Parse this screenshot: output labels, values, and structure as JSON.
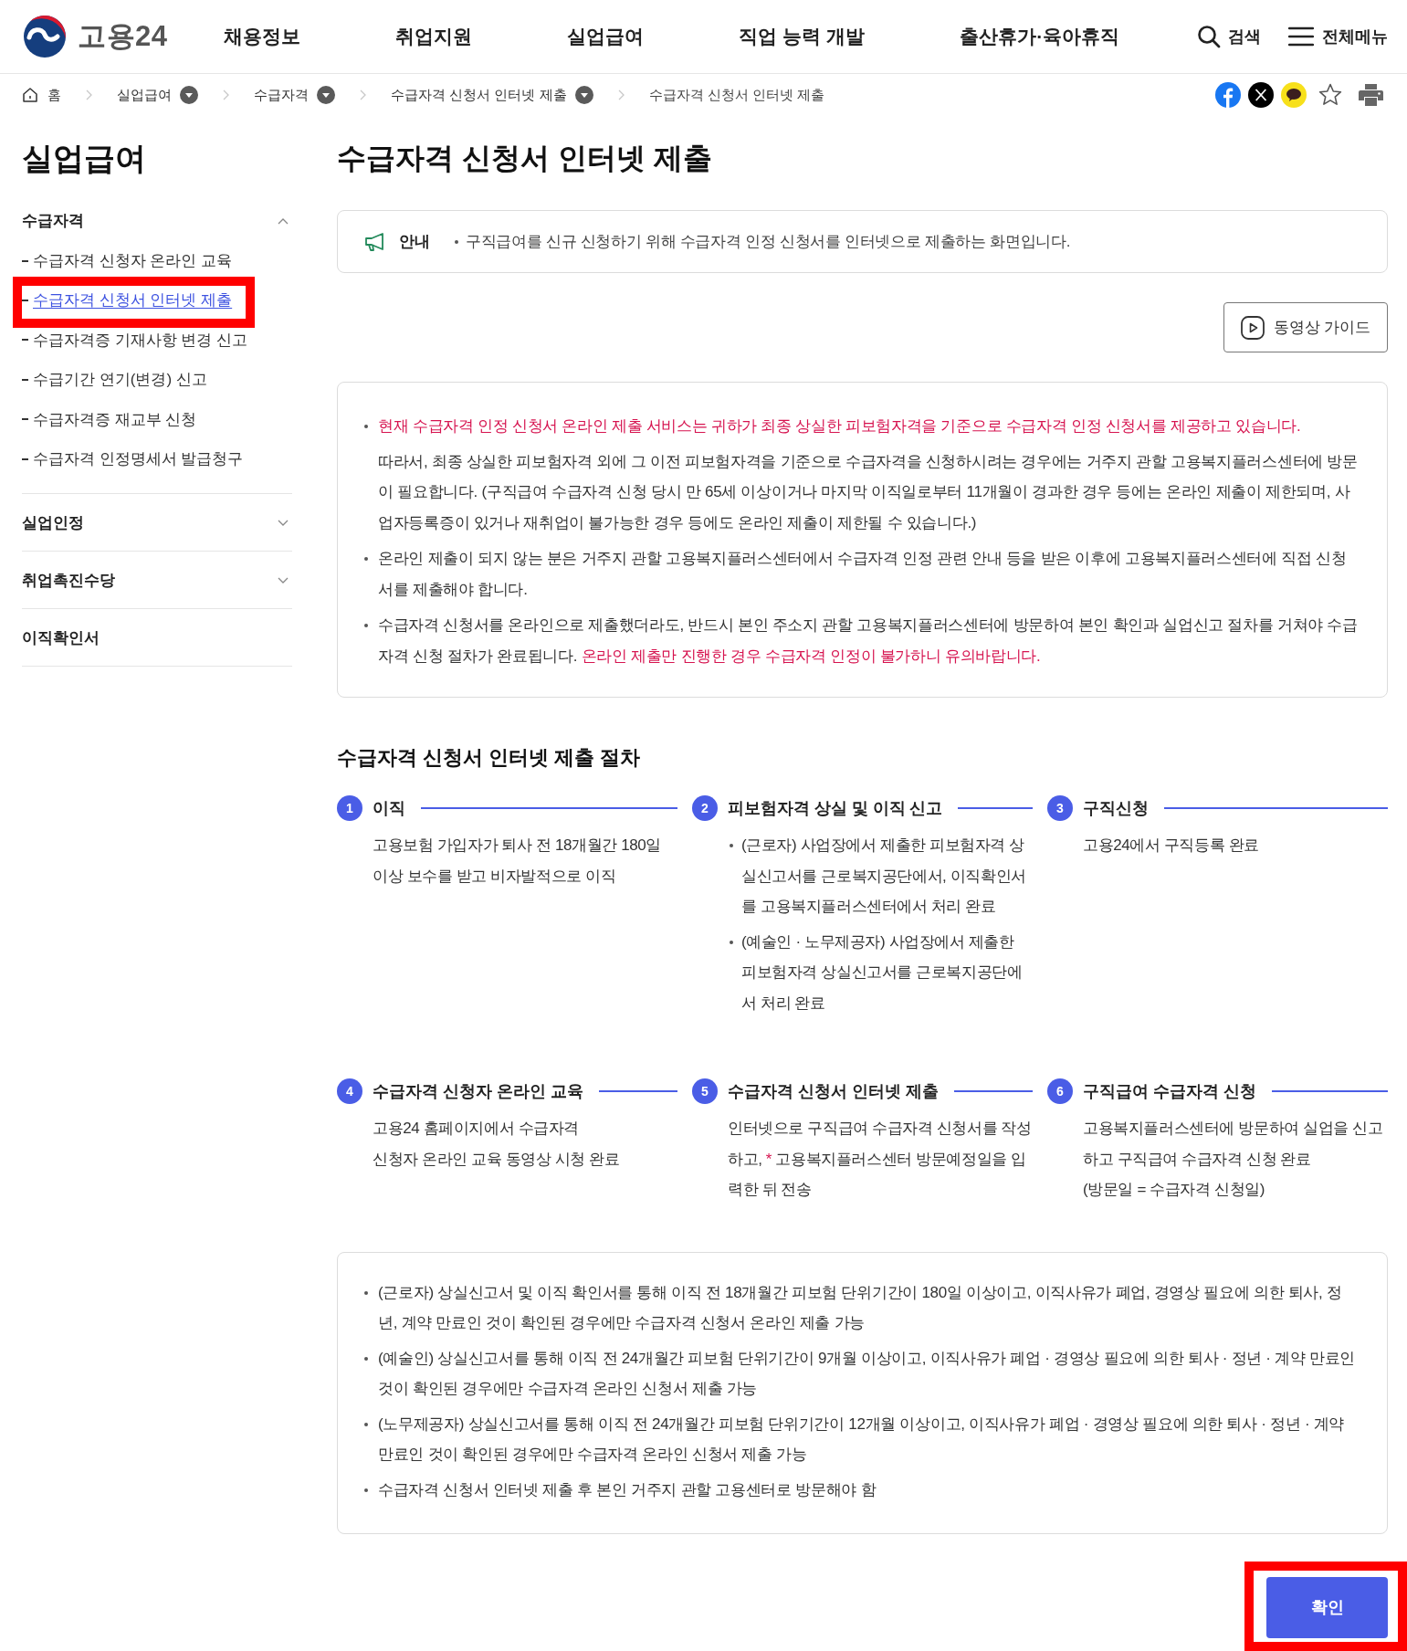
{
  "header": {
    "logo": "고용24",
    "nav": [
      "채용정보",
      "취업지원",
      "실업급여",
      "직업 능력 개발",
      "출산휴가·육아휴직"
    ],
    "search": "검색",
    "menu": "전체메뉴"
  },
  "breadcrumb": [
    {
      "label": "홈",
      "kind": "home"
    },
    {
      "label": "실업급여",
      "kind": "dropdown"
    },
    {
      "label": "수급자격",
      "kind": "dropdown"
    },
    {
      "label": "수급자격 신청서 인터넷 제출",
      "kind": "dropdown"
    },
    {
      "label": "수급자격 신청서 인터넷 제출",
      "kind": "current"
    }
  ],
  "sidebar": {
    "title": "실업급여",
    "groups": [
      {
        "label": "수급자격",
        "kind": "accordion",
        "expanded": true,
        "children": [
          {
            "label": "수급자격 신청자 온라인 교육",
            "selected": false,
            "highlighted": false
          },
          {
            "label": "수급자격 신청서 인터넷 제출",
            "selected": true,
            "highlighted": true
          },
          {
            "label": "수급자격증 기재사항 변경 신고",
            "selected": false,
            "highlighted": false
          },
          {
            "label": "수급기간 연기(변경) 신고",
            "selected": false,
            "highlighted": false
          },
          {
            "label": "수급자격증 재교부 신청",
            "selected": false,
            "highlighted": false
          },
          {
            "label": "수급자격 인정명세서 발급청구",
            "selected": false,
            "highlighted": false
          }
        ]
      },
      {
        "label": "실업인정",
        "kind": "accordion",
        "expanded": false
      },
      {
        "label": "취업촉진수당",
        "kind": "accordion",
        "expanded": false
      },
      {
        "label": "이직확인서",
        "kind": "link"
      }
    ]
  },
  "page_title": "수급자격 신청서 인터넷 제출",
  "notice": {
    "label": "안내",
    "text": "구직급여를 신규 신청하기 위해 수급자격 인정 신청서를 인터넷으로 제출하는 화면입니다."
  },
  "video_guide": {
    "label": "동영상 가이드"
  },
  "info": [
    {
      "parts": [
        {
          "text": "현재 수급자격 인정 신청서 온라인 제출 서비스는 귀하가 최종 상실한 피보험자격을 기준으로 수급자격 인정 신청서를 제공하고 있습니다.",
          "emphasis": true
        }
      ],
      "note": "따라서, 최종 상실한 피보험자격 외에 그 이전 피보험자격을 기준으로 수급자격을 신청하시려는 경우에는 거주지 관할 고용복지플러스센터에 방문이 필요합니다. (구직급여 수급자격 신청 당시 만 65세 이상이거나 마지막 이직일로부터 11개월이 경과한 경우 등에는 온라인 제출이 제한되며, 사업자등록증이 있거나 재취업이 불가능한 경우 등에도 온라인 제출이 제한될 수 있습니다.)"
    },
    {
      "parts": [
        {
          "text": "온라인 제출이 되지 않는 분은 거주지 관할 고용복지플러스센터에서 수급자격 인정 관련 안내 등을 받은 이후에 고용복지플러스센터에 직접 신청서를 제출해야 합니다.",
          "emphasis": false
        }
      ]
    },
    {
      "parts": [
        {
          "text": "수급자격 신청서를 온라인으로 제출했더라도, 반드시 본인 주소지 관할 고용복지플러스센터에 방문하여 본인 확인과 실업신고 절차를 거쳐야 수급자격 신청 절차가 완료됩니다.",
          "emphasis": false
        },
        {
          "text": "온라인 제출만 진행한 경우 수급자격 인정이 불가하니 유의바랍니다.",
          "emphasis": true
        }
      ]
    }
  ],
  "procedure": {
    "title": "수급자격 신청서 인터넷 제출 절차",
    "steps": [
      {
        "number": "1",
        "title": "이직",
        "body": [
          {
            "kind": "text",
            "parts": [
              {
                "text": "고용보험 가입자가 퇴사 전 18개월간 180일 이상 보수를 받고 비자발적으로 이직",
                "emphasis": false
              }
            ]
          }
        ]
      },
      {
        "number": "2",
        "title": "피보험자격 상실 및 이직 신고",
        "body": [
          {
            "kind": "bullet",
            "parts": [
              {
                "text": "(근로자) 사업장에서 제출한 피보험자격 상실신고서를 근로복지공단에서, 이직확인서를 고용복지플러스센터에서 처리 완료",
                "emphasis": false
              }
            ]
          },
          {
            "kind": "bullet",
            "parts": [
              {
                "text": "(예술인 · 노무제공자) 사업장에서 제출한 피보험자격 상실신고서를 근로복지공단에서 처리 완료",
                "emphasis": false
              }
            ]
          }
        ]
      },
      {
        "number": "3",
        "title": "구직신청",
        "body": [
          {
            "kind": "text",
            "parts": [
              {
                "text": "고용24에서 구직등록 완료",
                "emphasis": false
              }
            ]
          }
        ]
      },
      {
        "number": "4",
        "title": "수급자격 신청자 온라인 교육",
        "body": [
          {
            "kind": "text",
            "parts": [
              {
                "text": "고용24 홈페이지에서 수급자격",
                "emphasis": false
              }
            ]
          },
          {
            "kind": "text",
            "parts": [
              {
                "text": "신청자 온라인 교육 동영상 시청 완료",
                "emphasis": false
              }
            ]
          }
        ]
      },
      {
        "number": "5",
        "title": "수급자격 신청서 인터넷 제출",
        "body": [
          {
            "kind": "text",
            "parts": [
              {
                "text": "인터넷으로 구직급여 수급자격 신청서를 작성하고,",
                "emphasis": false
              },
              {
                "text": "*",
                "emphasis": true
              },
              {
                "text": "고용복지플러스센터 방문예정일을 입력한 뒤 전송",
                "emphasis": false
              }
            ]
          }
        ]
      },
      {
        "number": "6",
        "title": "구직급여 수급자격 신청",
        "body": [
          {
            "kind": "text",
            "parts": [
              {
                "text": "고용복지플러스센터에 방문하여 실업을 신고하고 구직급여 수급자격 신청 완료",
                "emphasis": false
              }
            ]
          },
          {
            "kind": "text",
            "parts": [
              {
                "text": "(방문일 = 수급자격 신청일)",
                "emphasis": false
              }
            ]
          }
        ]
      }
    ]
  },
  "conditions": [
    "(근로자) 상실신고서 및 이직 확인서를 통해 이직 전 18개월간 피보험 단위기간이 180일 이상이고, 이직사유가 폐업, 경영상 필요에 의한 퇴사, 정년, 계약 만료인 것이 확인된 경우에만 수급자격 신청서 온라인 제출 가능",
    "(예술인) 상실신고서를 통해 이직 전 24개월간 피보험 단위기간이 9개월 이상이고, 이직사유가 폐업 · 경영상 필요에 의한 퇴사 · 정년 · 계약 만료인 것이 확인된 경우에만 수급자격 온라인 신청서 제출 가능",
    "(노무제공자) 상실신고서를 통해 이직 전 24개월간 피보험 단위기간이 12개월 이상이고, 이직사유가 폐업 · 경영상 필요에 의한 퇴사 · 정년 · 계약 만료인 것이 확인된 경우에만 수급자격 온라인 신청서 제출 가능",
    "수급자격 신청서 인터넷 제출 후 본인 거주지 관할 고용센터로 방문해야 함"
  ],
  "confirm": {
    "label": "확인",
    "highlighted": true
  }
}
